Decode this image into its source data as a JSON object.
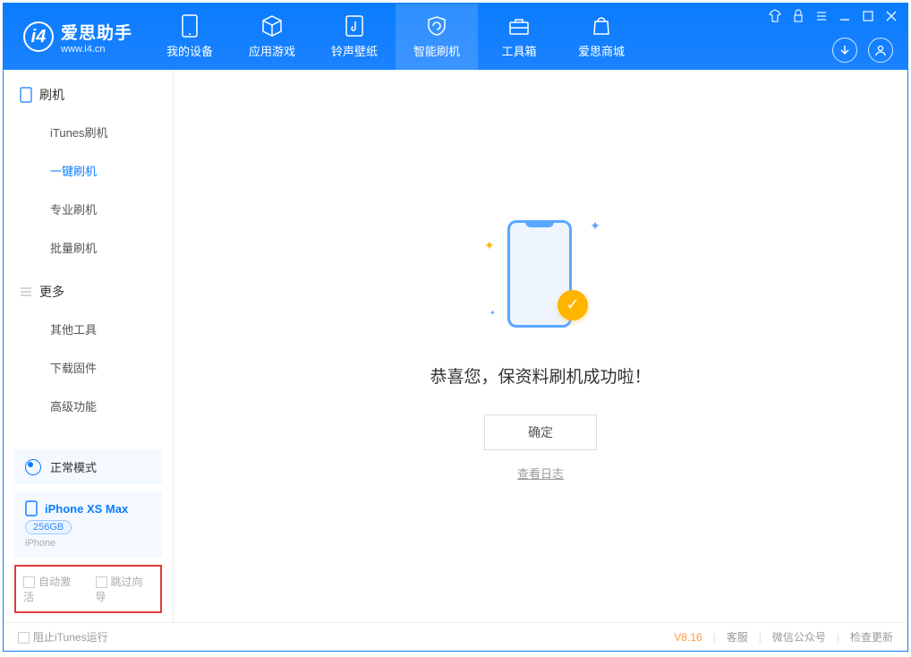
{
  "app": {
    "name_cn": "爱思助手",
    "name_en": "www.i4.cn"
  },
  "nav": {
    "items": [
      {
        "label": "我的设备"
      },
      {
        "label": "应用游戏"
      },
      {
        "label": "铃声壁纸"
      },
      {
        "label": "智能刷机"
      },
      {
        "label": "工具箱"
      },
      {
        "label": "爱思商城"
      }
    ]
  },
  "sidebar": {
    "section1": {
      "title": "刷机",
      "items": [
        "iTunes刷机",
        "一键刷机",
        "专业刷机",
        "批量刷机"
      ]
    },
    "section2": {
      "title": "更多",
      "items": [
        "其他工具",
        "下载固件",
        "高级功能"
      ]
    },
    "mode": "正常模式",
    "device": {
      "name": "iPhone XS Max",
      "capacity": "256GB",
      "type": "iPhone"
    },
    "checkboxes": {
      "auto_activate": "自动激活",
      "skip_guide": "跳过向导"
    }
  },
  "main": {
    "success_message": "恭喜您，保资料刷机成功啦！",
    "ok_button": "确定",
    "view_log": "查看日志"
  },
  "footer": {
    "block_itunes": "阻止iTunes运行",
    "version": "V8.16",
    "links": [
      "客服",
      "微信公众号",
      "检查更新"
    ]
  }
}
